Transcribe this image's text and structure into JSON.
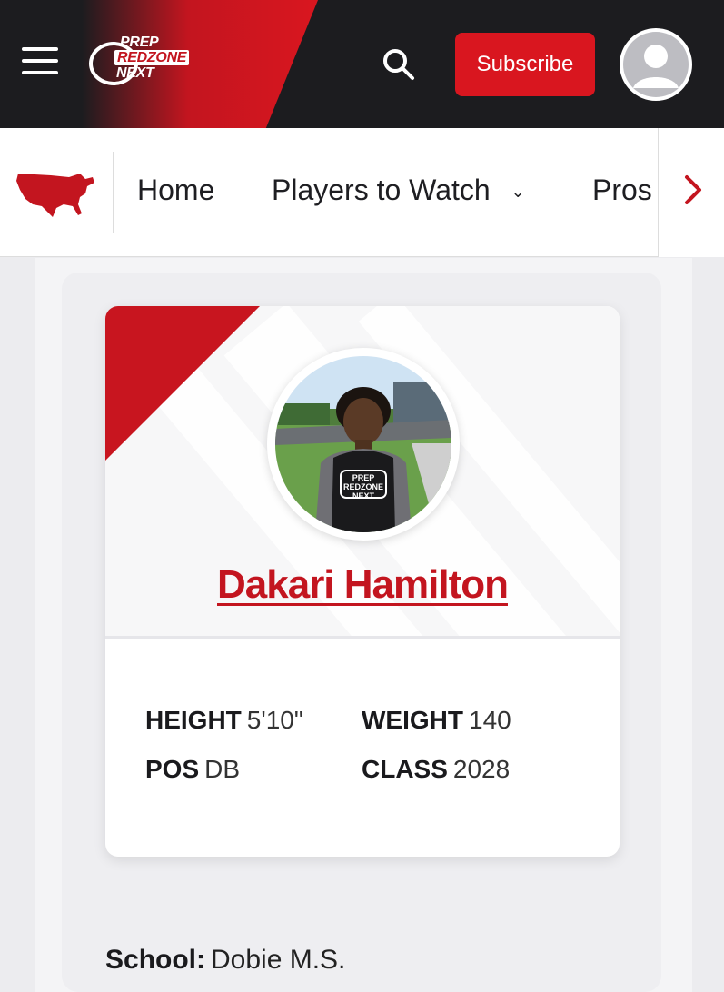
{
  "header": {
    "logo": {
      "line1": "PREP",
      "line2": "REDZONE",
      "line3": "NEXT"
    },
    "subscribe_label": "Subscribe",
    "icons": {
      "menu": "hamburger-menu-icon",
      "search": "search-icon",
      "account": "user-avatar-icon"
    },
    "colors": {
      "background": "#1c1c1f",
      "accent": "#d9161f"
    }
  },
  "nav": {
    "items": [
      {
        "label": "Home"
      },
      {
        "label": "Players to Watch",
        "has_dropdown": true
      },
      {
        "label": "Pros"
      }
    ],
    "icons": {
      "region": "usa-map-icon",
      "scroll": "chevron-right-icon",
      "dropdown": "chevron-down-icon"
    }
  },
  "profile": {
    "name": "Dakari Hamilton",
    "stats": {
      "height_label": "HEIGHT",
      "height_value": "5'10\"",
      "weight_label": "WEIGHT",
      "weight_value": "140",
      "pos_label": "POS",
      "pos_value": "DB",
      "class_label": "CLASS",
      "class_value": "2028"
    },
    "photo": "player-photo",
    "shirt_logo": {
      "line1": "PREP",
      "line2": "REDZONE",
      "line3": "NEXT"
    }
  },
  "details": {
    "school_label": "School:",
    "school_value": "Dobie M.S."
  }
}
